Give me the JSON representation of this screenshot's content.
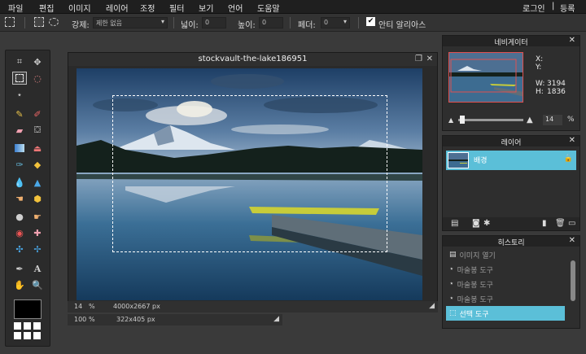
{
  "menu": {
    "items": [
      "파일",
      "편집",
      "이미지",
      "레이어",
      "조정",
      "필터",
      "보기",
      "언어",
      "도움말"
    ],
    "login": "로그인",
    "sep": "|",
    "register": "등록"
  },
  "options": {
    "feather_label": "강제:",
    "feather_value": "제한 없음",
    "width_label": "넓이:",
    "width_value": "0",
    "height_label": "높이:",
    "height_value": "0",
    "feather2_label": "페더:",
    "feather2_value": "0",
    "antialias_label": "안티 알리아스",
    "antialias_checked": "✔"
  },
  "document": {
    "title": "stockvault-the-lake186951",
    "zoom": "14",
    "zoom_unit": "%",
    "size": "4000x2667 px",
    "zoom2": "100",
    "zoom2_unit": "%",
    "size2": "322x405 px"
  },
  "navigator": {
    "title": "네비게이터",
    "x_label": "X:",
    "y_label": "Y:",
    "w_label": "W:",
    "w_value": "3194",
    "h_label": "H:",
    "h_value": "1836",
    "zoom": "14",
    "zoom_unit": "%",
    "zoom_level": 0.14
  },
  "layers": {
    "title": "레이어",
    "layer_name": "배경"
  },
  "history": {
    "title": "히스토리",
    "items": [
      "이미지 열기",
      "마술봉 도구",
      "마술봉 도구",
      "마술봉 도구",
      "선택 도구"
    ]
  },
  "colors": {
    "accent": "#5bbfd8",
    "background": "#3a3a3a",
    "menubar": "#1f1f1f"
  }
}
